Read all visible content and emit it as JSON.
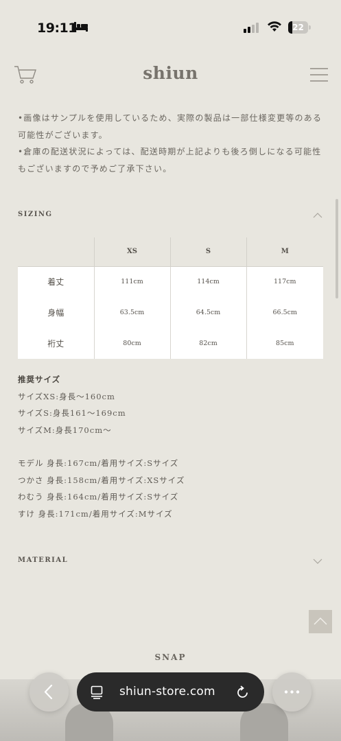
{
  "status_bar": {
    "time": "19:11",
    "battery_level": "22",
    "battery_fraction": 0.22
  },
  "header": {
    "logo": "shiun",
    "icons": [
      "cart-icon",
      "menu-icon"
    ]
  },
  "notes": {
    "line1": "•画像はサンプルを使用しているため、実際の製品は一部仕様変更等のある可能性がございます。",
    "line2": "•倉庫の配送状況によっては、配送時期が上記よりも後ろ倒しになる可能性もございますので予めご了承下さい。"
  },
  "sizing": {
    "title": "SIZING",
    "columns": [
      "",
      "XS",
      "S",
      "M"
    ],
    "rows": [
      {
        "label": "着丈",
        "xs": "111cm",
        "s": "114cm",
        "m": "117cm"
      },
      {
        "label": "身幅",
        "xs": "63.5cm",
        "s": "64.5cm",
        "m": "66.5cm"
      },
      {
        "label": "裄丈",
        "xs": "80cm",
        "s": "82cm",
        "m": "85cm"
      }
    ]
  },
  "recommended": {
    "title": "推奨サイズ",
    "lines": [
      "サイズXS:身長～160cm",
      "サイズS:身長161～169cm",
      "サイズM:身長170cm～"
    ]
  },
  "models": [
    "モデル 身長:167cm/着用サイズ:Sサイズ",
    "つかさ 身長:158cm/着用サイズ:XSサイズ",
    "わむう 身長:164cm/着用サイズ:Sサイズ",
    "すけ 身長:171cm/着用サイズ:Mサイズ"
  ],
  "material": {
    "title": "MATERIAL"
  },
  "snap": {
    "title": "SNAP"
  },
  "browser": {
    "url": "shiun-store.com",
    "icons": [
      "back-icon",
      "page-icon",
      "reload-icon",
      "more-icon"
    ]
  }
}
